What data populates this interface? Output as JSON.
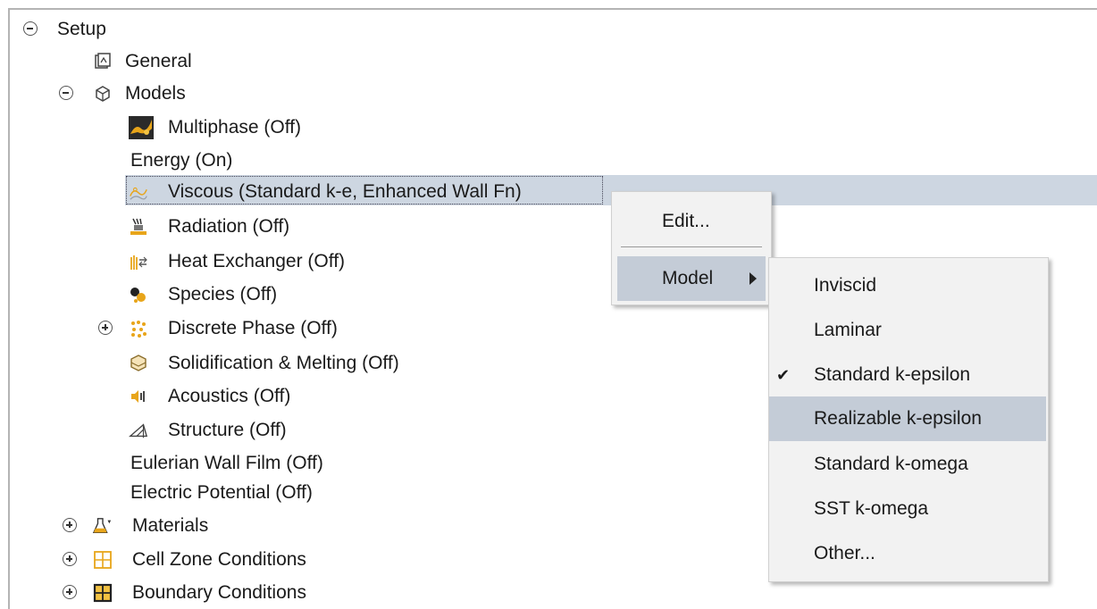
{
  "tree": {
    "setup": "Setup",
    "general": "General",
    "models": "Models",
    "multiphase": "Multiphase (Off)",
    "energy": "Energy (On)",
    "viscous": "Viscous (Standard k-e, Enhanced Wall Fn)",
    "radiation": "Radiation (Off)",
    "heat_exchanger": "Heat Exchanger (Off)",
    "species": "Species (Off)",
    "discrete_phase": "Discrete Phase (Off)",
    "solidification": "Solidification & Melting (Off)",
    "acoustics": "Acoustics (Off)",
    "structure": "Structure (Off)",
    "eulerian_wall_film": "Eulerian Wall Film (Off)",
    "electric_potential": "Electric Potential (Off)",
    "materials": "Materials",
    "cell_zone_conditions": "Cell Zone Conditions",
    "boundary_conditions": "Boundary Conditions"
  },
  "context_menu": {
    "edit": "Edit...",
    "model": "Model"
  },
  "model_submenu": {
    "inviscid": "Inviscid",
    "laminar": "Laminar",
    "standard_k_epsilon": "Standard k-epsilon",
    "checkmark": "✔",
    "realizable_k_epsilon": "Realizable k-epsilon",
    "standard_k_omega": "Standard k-omega",
    "sst_k_omega": "SST k-omega",
    "other": "Other..."
  },
  "icons": {
    "general": "general-icon",
    "models": "models-icon",
    "multiphase": "multiphase-icon",
    "viscous": "viscous-icon",
    "radiation": "radiation-icon",
    "heat_exchanger": "heat-exchanger-icon",
    "species": "species-icon",
    "discrete_phase": "discrete-phase-icon",
    "solidification": "solidification-icon",
    "acoustics": "acoustics-icon",
    "structure": "structure-icon",
    "materials": "materials-icon",
    "cell_zone": "cell-zone-icon",
    "boundary": "boundary-icon"
  },
  "colors": {
    "selection": "#cdd6e1",
    "menu_highlight": "#c4ccd7",
    "icon_orange": "#e8a51a"
  }
}
